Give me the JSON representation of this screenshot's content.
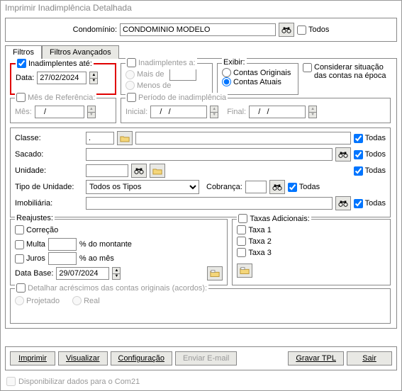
{
  "window_title": "Imprimir Inadimplência Detalhada",
  "condominio": {
    "label": "Condomínio:",
    "value": "CONDOMINIO MODELO",
    "todos": "Todos"
  },
  "tabs": {
    "filtros": "Filtros",
    "avancados": "Filtros Avançados"
  },
  "inad_ate": {
    "legend": "Inadimplentes até:",
    "data_label": "Data:",
    "data_value": "27/02/2024"
  },
  "inad_a": {
    "legend": "Inadimplentes a:",
    "mais": "Mais de",
    "menos": "Menos de"
  },
  "exibir": {
    "legend": "Exibir:",
    "orig": "Contas Originais",
    "atuais": "Contas Atuais"
  },
  "considerar": "Considerar situação das contas na época",
  "mes_ref": {
    "legend": "Mês de Referência:",
    "mes_label": "Mês:",
    "mes_value": "   /      "
  },
  "periodo": {
    "legend": "Período de inadimplência",
    "inicial": "Inicial:",
    "final": "Final:",
    "val": "   /   /      "
  },
  "classe_label": "Classe:",
  "classe_small_value": ".",
  "sacado_label": "Sacado:",
  "unidade_label": "Unidade:",
  "tipo_unidade_label": "Tipo de Unidade:",
  "tipo_unidade_value": "Todos os Tipos",
  "cobranca_label": "Cobrança:",
  "imobiliaria_label": "Imobiliária:",
  "todas": "Todas",
  "todos": "Todos",
  "reajustes": {
    "legend": "Reajustes:",
    "correcao": "Correção",
    "multa": "Multa",
    "multa_suffix": "% do montante",
    "juros": "Juros",
    "juros_suffix": "% ao mês",
    "data_base": "Data Base:",
    "data_base_value": "29/07/2024"
  },
  "taxas": {
    "legend": "Taxas Adicionais:",
    "t1": "Taxa 1",
    "t2": "Taxa 2",
    "t3": "Taxa 3"
  },
  "detalhar": {
    "legend": "Detalhar acréscimos das contas originais (acordos):",
    "proj": "Projetado",
    "real": "Real"
  },
  "buttons": {
    "imprimir": "Imprimir",
    "visualizar": "Visualizar",
    "config": "Configuração",
    "enviar": "Enviar E-mail",
    "gravar": "Gravar TPL",
    "sair": "Sair"
  },
  "footer": "Disponibilizar dados para o Com21"
}
